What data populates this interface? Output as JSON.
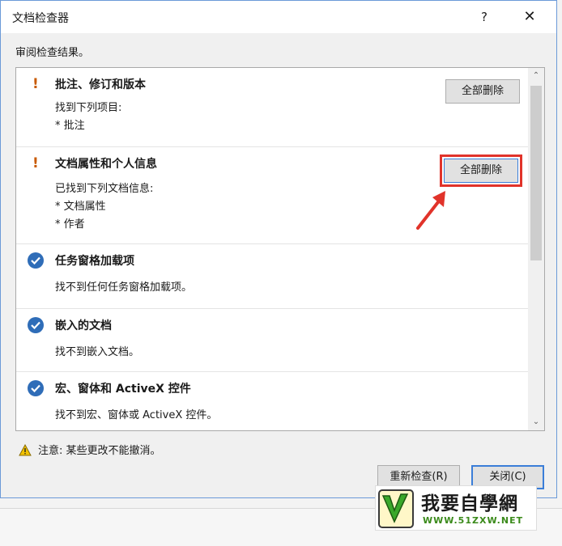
{
  "dialog": {
    "title": "文档检查器",
    "help_label": "?",
    "close_glyph": "✕",
    "subtitle": "审阅检查结果。"
  },
  "items": [
    {
      "status": "warning",
      "mark": "!",
      "title": "批注、修订和版本",
      "lines": [
        "找到下列项目:",
        "* 批注"
      ],
      "action_label": "全部删除"
    },
    {
      "status": "warning",
      "mark": "!",
      "title": "文档属性和个人信息",
      "lines": [
        "已找到下列文档信息:",
        "* 文档属性",
        "* 作者"
      ],
      "action_label": "全部删除"
    },
    {
      "status": "ok",
      "title": "任务窗格加载项",
      "lines": [
        "找不到任何任务窗格加载项。"
      ]
    },
    {
      "status": "ok",
      "title": "嵌入的文档",
      "lines": [
        "找不到嵌入文档。"
      ]
    },
    {
      "status": "ok",
      "title": "宏、窗体和 ActiveX 控件",
      "lines": [
        "找不到宏、窗体或 ActiveX 控件。"
      ]
    }
  ],
  "scroll": {
    "up_glyph": "⌃",
    "down_glyph": "⌄"
  },
  "note": "注意: 某些更改不能撤消。",
  "buttons": {
    "reinspect_label": "重新检查(R)",
    "close_label": "关闭(C)"
  },
  "watermark": {
    "name": "我要自學網",
    "url": "WWW.51ZXW.NET"
  },
  "colors": {
    "warning": "#c85a00",
    "ok": "#2f6db8",
    "highlight": "#e1332a"
  }
}
